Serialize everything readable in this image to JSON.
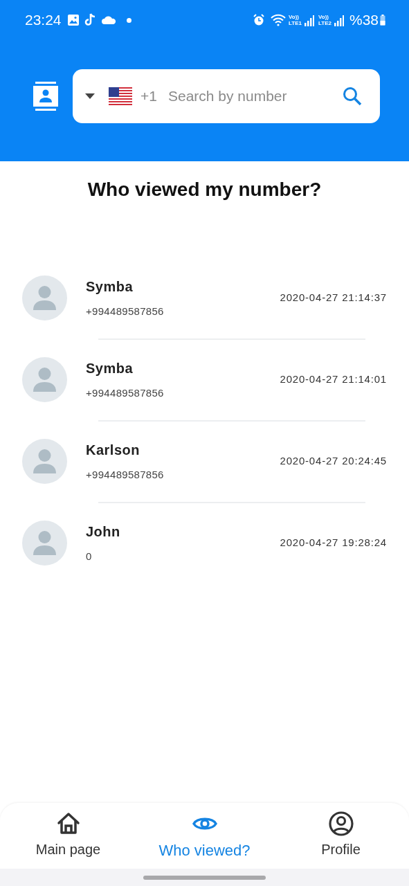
{
  "status_bar": {
    "time": "23:24",
    "sim_labels": [
      {
        "top": "Vo))",
        "bottom": "LTE1"
      },
      {
        "top": "Vo))",
        "bottom": "LTE2"
      }
    ],
    "battery": "%38"
  },
  "search": {
    "country_code": "+1",
    "placeholder": "Search by number"
  },
  "title": "Who viewed my number?",
  "viewers": [
    {
      "name": "Symba",
      "number": "+994489587856",
      "time": "2020-04-27 21:14:37"
    },
    {
      "name": "Symba",
      "number": "+994489587856",
      "time": "2020-04-27 21:14:01"
    },
    {
      "name": "Karlson",
      "number": "+994489587856",
      "time": "2020-04-27 20:24:45"
    },
    {
      "name": "John",
      "number": "0",
      "time": "2020-04-27 19:28:24"
    }
  ],
  "nav": [
    {
      "label": "Main page",
      "kind": "home",
      "selected": false
    },
    {
      "label": "Who viewed?",
      "kind": "eye",
      "selected": true
    },
    {
      "label": "Profile",
      "kind": "profile",
      "selected": false
    }
  ]
}
